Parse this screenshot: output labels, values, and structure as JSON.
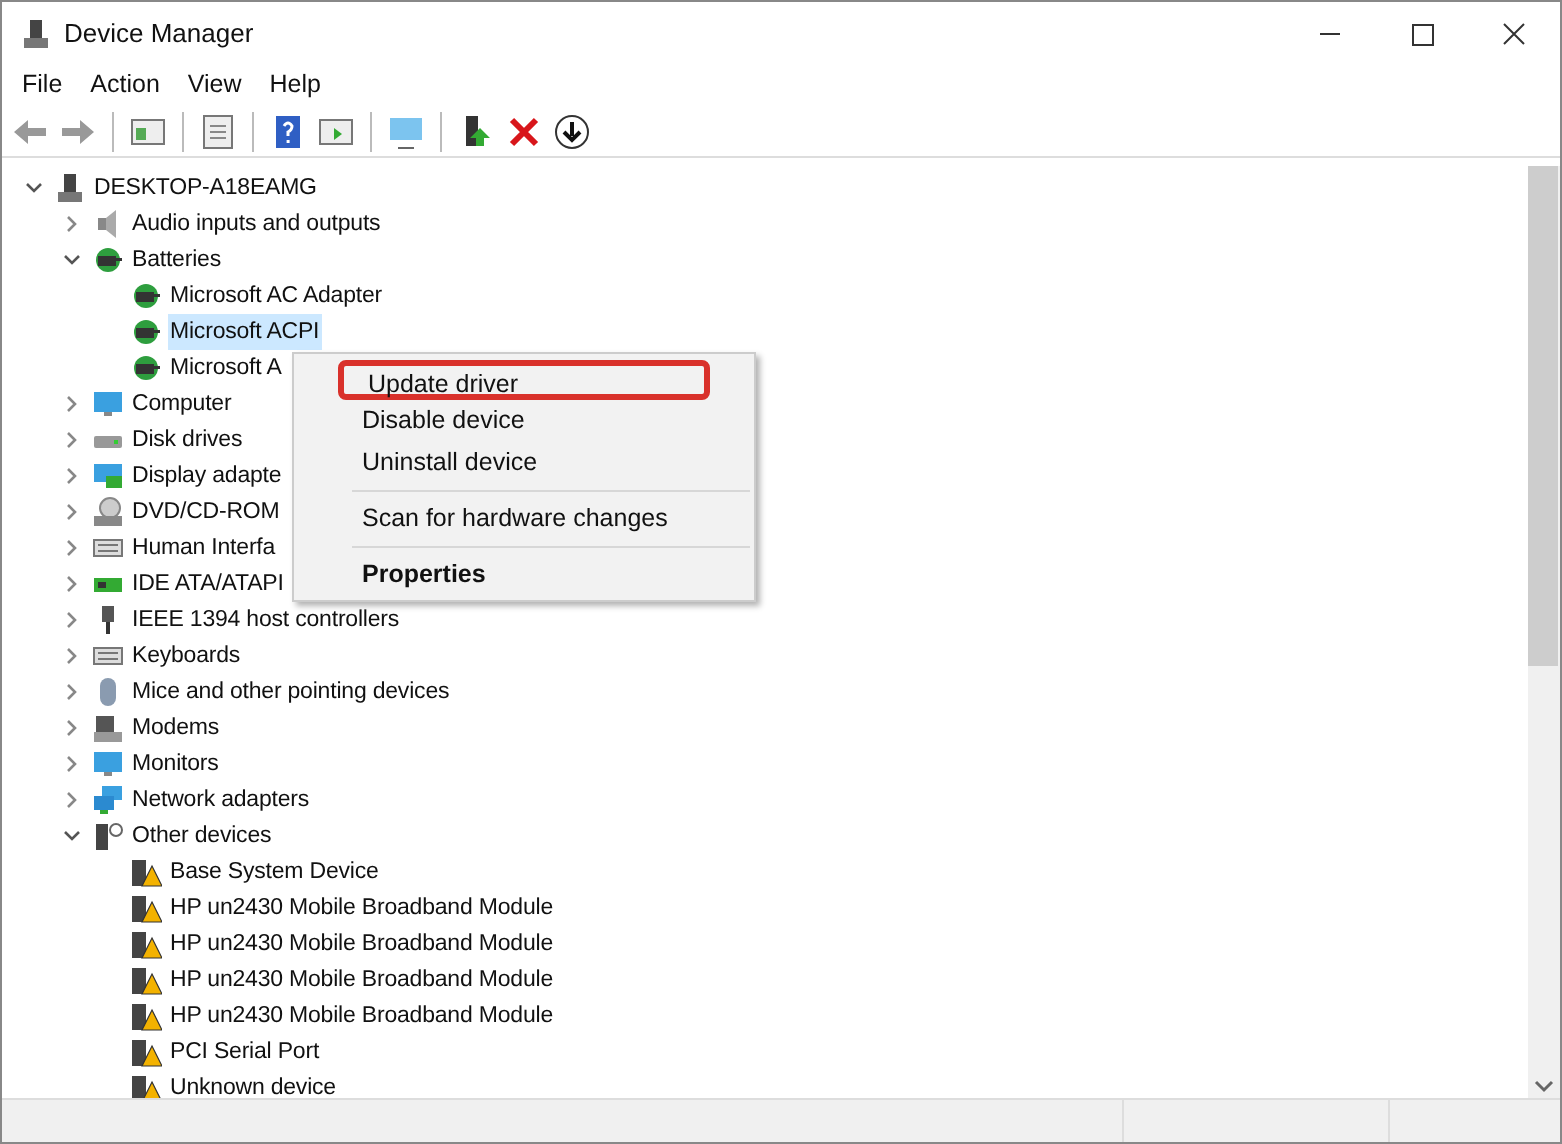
{
  "window": {
    "title": "Device Manager"
  },
  "menu_bar": [
    "File",
    "Action",
    "View",
    "Help"
  ],
  "tree": {
    "label": "DESKTOP-A18EAMG",
    "kind": "computer",
    "expanded": true,
    "selected": false,
    "children": [
      {
        "label": "Audio inputs and outputs",
        "kind": "speaker",
        "expanded": false,
        "selected": false
      },
      {
        "label": "Batteries",
        "kind": "battery",
        "expanded": true,
        "selected": false,
        "children": [
          {
            "label": "Microsoft AC Adapter",
            "kind": "battery",
            "selected": false
          },
          {
            "label": "Microsoft ACPI",
            "kind": "battery",
            "selected": true
          },
          {
            "label": "Microsoft A",
            "kind": "battery",
            "selected": false
          }
        ]
      },
      {
        "label": "Computer",
        "kind": "monitor",
        "expanded": false,
        "selected": false
      },
      {
        "label": "Disk drives",
        "kind": "disk",
        "expanded": false,
        "selected": false
      },
      {
        "label": "Display adapte",
        "kind": "display",
        "expanded": false,
        "selected": false
      },
      {
        "label": "DVD/CD-ROM",
        "kind": "dvd",
        "expanded": false,
        "selected": false
      },
      {
        "label": "Human Interfa",
        "kind": "hid",
        "expanded": false,
        "selected": false
      },
      {
        "label": "IDE ATA/ATAPI",
        "kind": "card",
        "expanded": false,
        "selected": false
      },
      {
        "label": "IEEE 1394 host controllers",
        "kind": "plug",
        "expanded": false,
        "selected": false
      },
      {
        "label": "Keyboards",
        "kind": "keyboard",
        "expanded": false,
        "selected": false
      },
      {
        "label": "Mice and other pointing devices",
        "kind": "mouse",
        "expanded": false,
        "selected": false
      },
      {
        "label": "Modems",
        "kind": "modem",
        "expanded": false,
        "selected": false
      },
      {
        "label": "Monitors",
        "kind": "monitor",
        "expanded": false,
        "selected": false
      },
      {
        "label": "Network adapters",
        "kind": "network",
        "expanded": false,
        "selected": false
      },
      {
        "label": "Other devices",
        "kind": "unknown",
        "expanded": true,
        "selected": false,
        "children": [
          {
            "label": "Base System Device",
            "kind": "warning",
            "selected": false
          },
          {
            "label": "HP un2430 Mobile Broadband Module",
            "kind": "warning",
            "selected": false
          },
          {
            "label": "HP un2430 Mobile Broadband Module",
            "kind": "warning",
            "selected": false
          },
          {
            "label": "HP un2430 Mobile Broadband Module",
            "kind": "warning",
            "selected": false
          },
          {
            "label": "HP un2430 Mobile Broadband Module",
            "kind": "warning",
            "selected": false
          },
          {
            "label": "PCI Serial Port",
            "kind": "warning",
            "selected": false
          },
          {
            "label": "Unknown device",
            "kind": "warning",
            "selected": false
          }
        ]
      }
    ]
  },
  "context_menu": [
    {
      "kind": "item",
      "label": "Update driver",
      "selected": true,
      "default": false
    },
    {
      "kind": "item",
      "label": "Disable device",
      "selected": false,
      "default": false
    },
    {
      "kind": "item",
      "label": "Uninstall device",
      "selected": false,
      "default": false
    },
    {
      "kind": "separator"
    },
    {
      "kind": "item",
      "label": "Scan for hardware changes",
      "selected": false,
      "default": false
    },
    {
      "kind": "separator"
    },
    {
      "kind": "item",
      "label": "Properties",
      "selected": false,
      "default": true
    }
  ]
}
